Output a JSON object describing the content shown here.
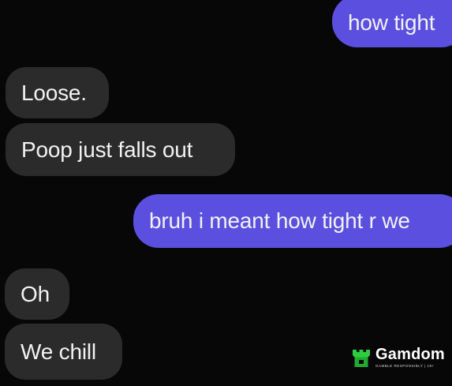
{
  "conversation": {
    "messages": [
      {
        "sender": "me",
        "text": "how tight"
      },
      {
        "sender": "them",
        "text": "Loose."
      },
      {
        "sender": "them",
        "text": "Poop just falls out"
      },
      {
        "sender": "me",
        "text": "bruh i meant how tight r we"
      },
      {
        "sender": "them",
        "text": "Oh"
      },
      {
        "sender": "them",
        "text": "We chill"
      }
    ]
  },
  "watermark": {
    "brand": "Gamdom",
    "tagline": "GAMBLE RESPONSIBLY | 18+",
    "logo_icon": "gamdom-logo-icon",
    "logo_color": "#2ecc40"
  },
  "colors": {
    "background": "#070707",
    "incoming_bubble": "#2b2b2b",
    "outgoing_bubble": "#5b4fe0",
    "text": "#f2f2f2"
  }
}
